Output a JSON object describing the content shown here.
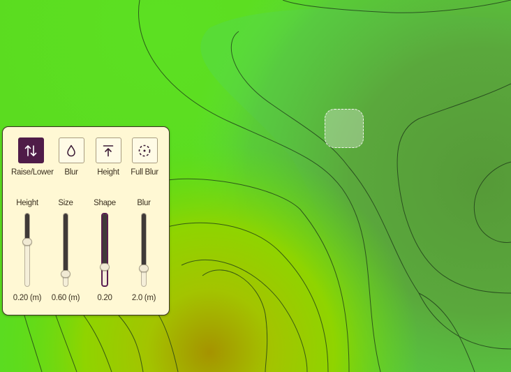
{
  "tools": [
    {
      "id": "raise-lower",
      "label": "Raise/Lower",
      "icon": "raise-lower-icon",
      "active": true
    },
    {
      "id": "blur",
      "label": "Blur",
      "icon": "droplet-icon",
      "active": false
    },
    {
      "id": "height",
      "label": "Height",
      "icon": "set-height-icon",
      "active": false
    },
    {
      "id": "full-blur",
      "label": "Full Blur",
      "icon": "full-blur-icon",
      "active": false
    }
  ],
  "sliders": [
    {
      "id": "height",
      "label": "Height",
      "value": "0.20 (m)",
      "level": 0.62
    },
    {
      "id": "size",
      "label": "Size",
      "value": "0.60 (m)",
      "level": 0.14
    },
    {
      "id": "shape",
      "label": "Shape",
      "value": "0.20",
      "level": 0.24
    },
    {
      "id": "blur",
      "label": "Blur",
      "value": "2.0 (m)",
      "level": 0.22
    }
  ],
  "colors": {
    "panel_bg": "#fff8d4",
    "accent": "#4f1c48",
    "terrain_high": "#58a03a",
    "terrain_mid": "#5fe040",
    "terrain_low": "#a59300"
  }
}
